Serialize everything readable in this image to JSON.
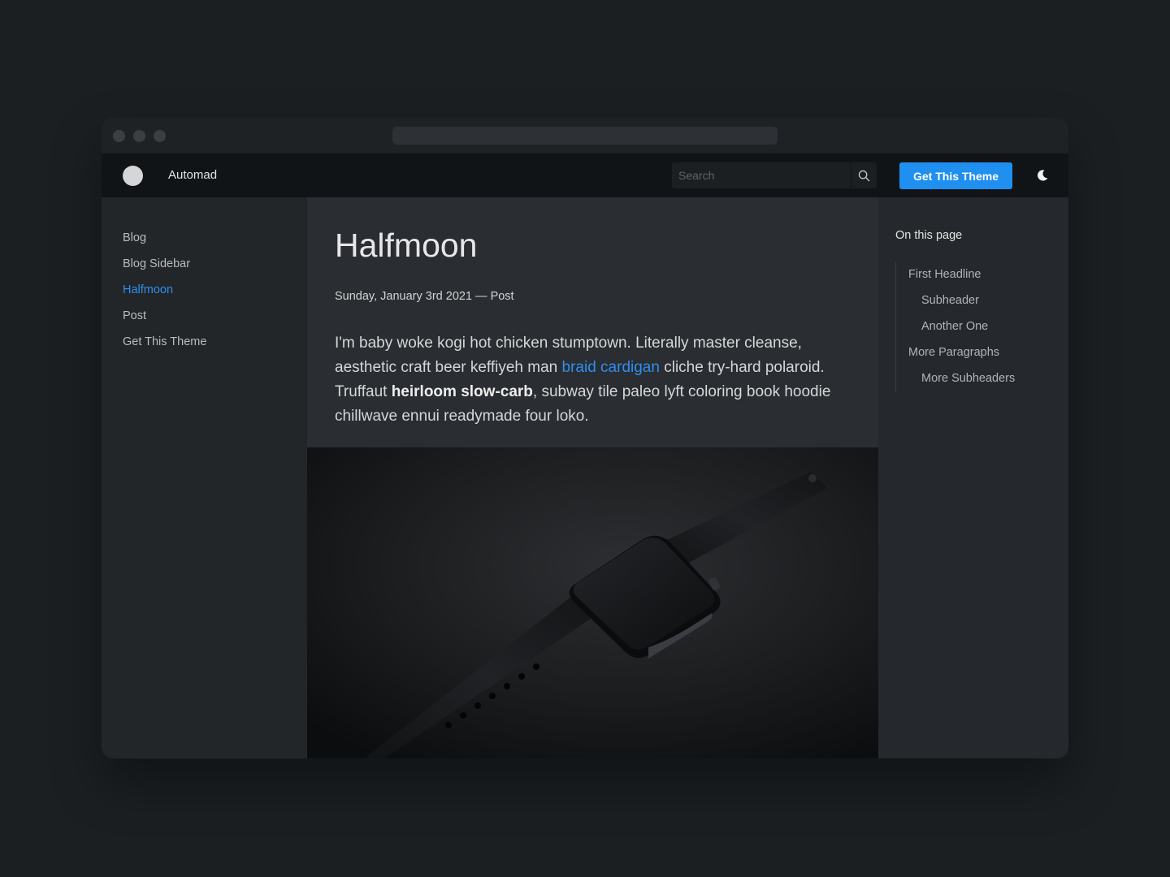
{
  "window": {
    "controls": [
      "close-dot",
      "minimize-dot",
      "zoom-dot"
    ]
  },
  "navbar": {
    "brand": "Automad",
    "search_placeholder": "Search",
    "search_icon": "search-icon",
    "cta_label": "Get This Theme",
    "theme_toggle_icon": "moon-icon"
  },
  "sidebar": {
    "items": [
      {
        "label": "Blog",
        "active": false
      },
      {
        "label": "Blog Sidebar",
        "active": false
      },
      {
        "label": "Halfmoon",
        "active": true
      },
      {
        "label": "Post",
        "active": false
      },
      {
        "label": "Get This Theme",
        "active": false
      }
    ]
  },
  "article": {
    "title": "Halfmoon",
    "meta": "Sunday, January 3rd 2021 — Post",
    "body": {
      "text1": "I'm baby woke kogi hot chicken stumptown. Literally master cleanse, aesthetic craft beer keffiyeh man ",
      "link": "braid cardigan",
      "text2": " cliche try-hard polaroid. Truffaut ",
      "bold": "heirloom slow-carb",
      "text3": ", subway tile paleo lyft coloring book hoodie chillwave ennui readymade four loko."
    },
    "image": "smartwatch-photo"
  },
  "toc": {
    "heading": "On this page",
    "items": [
      {
        "label": "First Headline",
        "level": 1
      },
      {
        "label": "Subheader",
        "level": 2
      },
      {
        "label": "Another One",
        "level": 2
      },
      {
        "label": "More Paragraphs",
        "level": 1
      },
      {
        "label": "More Subheaders",
        "level": 2
      }
    ]
  },
  "colors": {
    "accent": "#1f8ff0",
    "background": "#1b1f22",
    "navbar": "#111416"
  }
}
